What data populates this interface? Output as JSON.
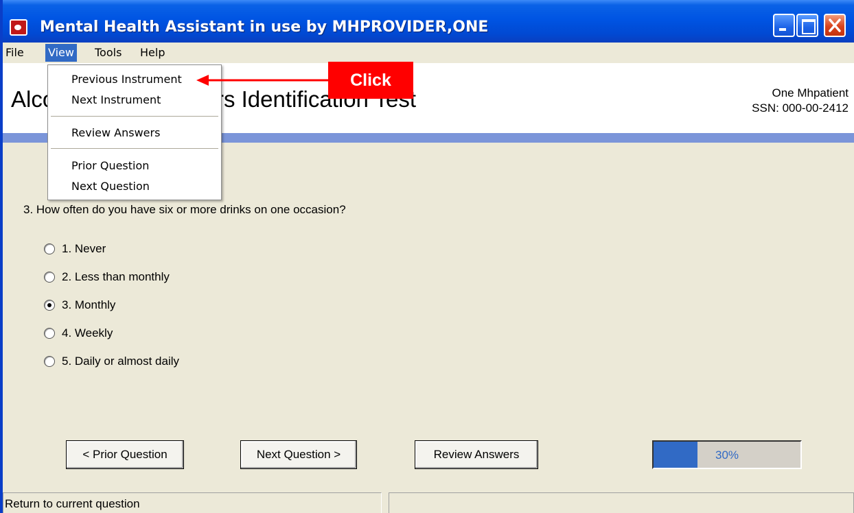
{
  "window": {
    "title": "Mental Health Assistant in use by MHPROVIDER,ONE",
    "title_bar_color": "#0054e3"
  },
  "menu": {
    "file": "File",
    "view": "View",
    "tools": "Tools",
    "help": "Help"
  },
  "view_menu": {
    "previous_instrument": "Previous Instrument",
    "next_instrument": "Next Instrument",
    "review_answers": "Review Answers",
    "prior_question": "Prior Question",
    "next_question": "Next Question"
  },
  "header": {
    "instrument_title": "Alcohol Use Disorders Identification Test",
    "patient_name": "One Mhpatient",
    "patient_ssn": "SSN: 000-00-2412"
  },
  "question": {
    "text": "3. How often do you have six or more drinks on one occasion?",
    "options": [
      {
        "label": "1. Never",
        "checked": false
      },
      {
        "label": "2. Less than monthly",
        "checked": false
      },
      {
        "label": "3. Monthly",
        "checked": true
      },
      {
        "label": "4. Weekly",
        "checked": false
      },
      {
        "label": "5. Daily or almost daily",
        "checked": false
      }
    ]
  },
  "buttons": {
    "prior": "< Prior Question",
    "next": "Next Question >",
    "review": "Review Answers"
  },
  "progress": {
    "value": 0.3,
    "label": "30%",
    "fill_color": "#316ac5"
  },
  "status": {
    "left": "Return to current question"
  },
  "annotation": {
    "callout": "Click",
    "color": "#ff0000"
  }
}
